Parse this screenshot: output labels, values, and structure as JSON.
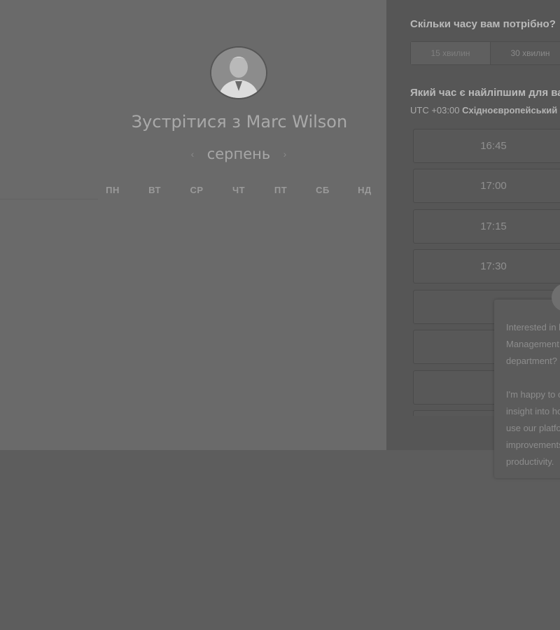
{
  "meeting": {
    "title": "Зустрітися з Marc Wilson",
    "avatar_icon": "person-photo"
  },
  "calendar": {
    "month": "серпень",
    "prev_icon": "chevron-left-icon",
    "next_icon": "chevron-right-icon",
    "prev_glyph": "‹",
    "next_glyph": "›",
    "weekdays": [
      "ПН",
      "ВТ",
      "СР",
      "ЧТ",
      "ПТ",
      "СБ",
      "НД"
    ]
  },
  "scheduler": {
    "duration_heading": "Скільки часу вам потрібно?",
    "durations": [
      "15 хвилин",
      "30 хвилин"
    ],
    "time_heading": "Який час є найліпшим для вас?",
    "timezone_prefix": "UTC +03:00",
    "timezone_name": "Східноєвропейський час",
    "slots": [
      "16:45",
      "17:00",
      "17:15",
      "17:30"
    ]
  },
  "chat": {
    "lines": [
      "Interested in how Time",
      "Management can help your",
      "department?",
      "",
      "I'm happy to offer some",
      "insight into how others",
      "use our platform to drive",
      "improvements in",
      "productivity."
    ]
  }
}
